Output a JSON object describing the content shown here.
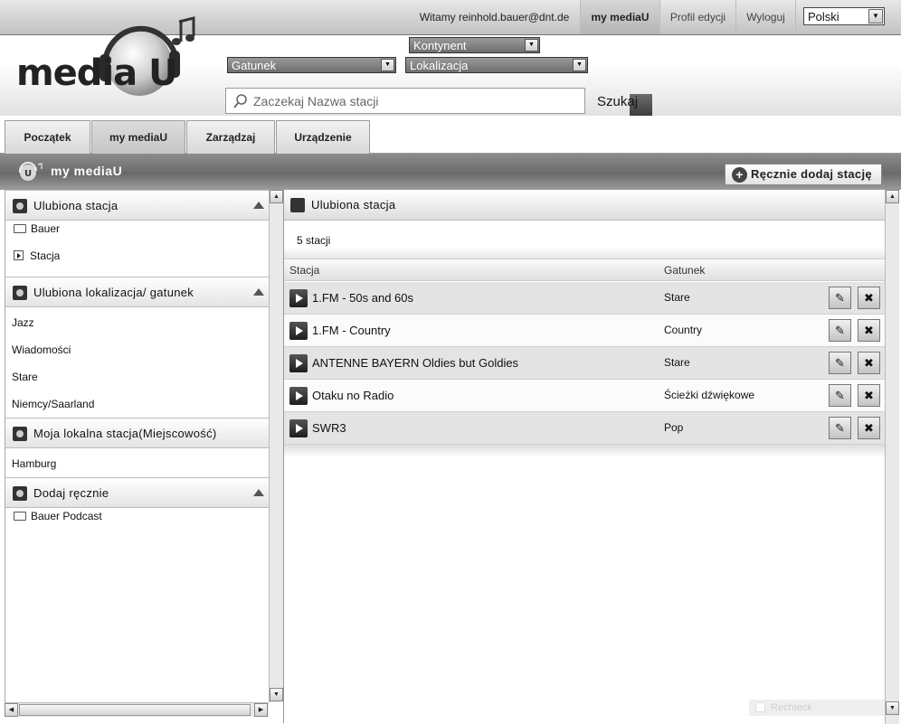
{
  "topbar": {
    "welcome": "Witamy reinhold.bauer@dnt.de",
    "my_mediau": "my mediaU",
    "profile": "Profil edycji",
    "logout": "Wyloguj",
    "language": "Polski"
  },
  "logo": {
    "text": "media U"
  },
  "filters": {
    "continent": "Kontynent",
    "genre": "Gatunek",
    "location": "Lokalizacja"
  },
  "search": {
    "placeholder": "Zaczekaj Nazwa stacji",
    "button": "Szukaj"
  },
  "nav": {
    "tabs": [
      "Początek",
      "my mediaU",
      "Zarządzaj",
      "Urządzenie"
    ],
    "active": "my mediaU"
  },
  "section": {
    "title": "my mediaU",
    "add_button": "Ręcznie dodaj stację"
  },
  "sidebar": {
    "favorite_station": {
      "title": "Ulubiona stacja",
      "items": [
        {
          "label": "Bauer",
          "icon": "folder-icon"
        },
        {
          "label": "Stacja",
          "icon": "play-icon"
        }
      ]
    },
    "favorite_location_genre": {
      "title": "Ulubiona lokalizacja/ gatunek",
      "items": [
        "Jazz",
        "Wiadomości",
        "Stare",
        "Niemcy/Saarland"
      ]
    },
    "local_station": {
      "title": "Moja lokalna stacja(Miejscowość)",
      "items": [
        "Hamburg"
      ]
    },
    "manual_add": {
      "title": "Dodaj ręcznie",
      "items": [
        {
          "label": "Bauer Podcast",
          "icon": "folder-icon"
        }
      ]
    }
  },
  "main": {
    "title": "Ulubiona stacja",
    "count": "5 stacji",
    "columns": {
      "station": "Stacja",
      "genre": "Gatunek"
    },
    "rows": [
      {
        "station": "1.FM - 50s and 60s",
        "genre": "Stare"
      },
      {
        "station": "1.FM - Country",
        "genre": "Country"
      },
      {
        "station": "ANTENNE BAYERN Oldies but Goldies",
        "genre": "Stare"
      },
      {
        "station": "Otaku no Radio",
        "genre": "Ścieżki dźwiękowe"
      },
      {
        "station": "SWR3",
        "genre": "Pop"
      }
    ]
  },
  "footer": {
    "watermark": "Rechteck"
  },
  "colors": {
    "accent": "#6a6a6a",
    "header_bar": "#c2c2c2"
  }
}
